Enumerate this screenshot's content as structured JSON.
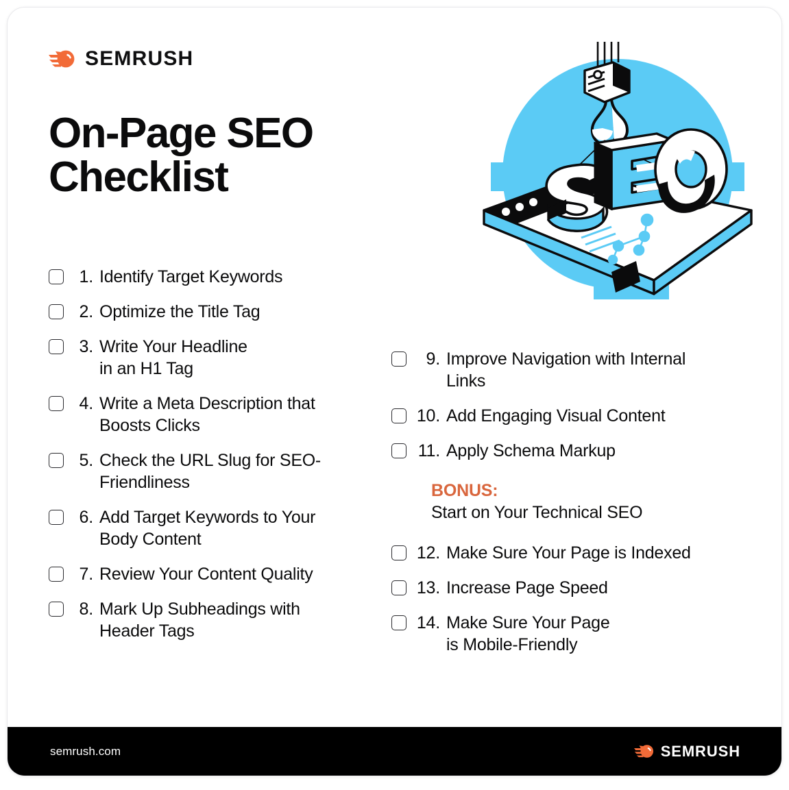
{
  "brand": {
    "name": "SEMRUSH",
    "logo_icon": "semrush-comet-icon",
    "accent_color": "#F26B38"
  },
  "title": "On-Page SEO Checklist",
  "illustration": {
    "name": "seo-crane-hook-browser-illustration",
    "word": "SEO",
    "circle_color": "#5BCBF5"
  },
  "left_column": [
    {
      "num": "1.",
      "text": "Identify Target Keywords"
    },
    {
      "num": "2.",
      "text": "Optimize the Title Tag"
    },
    {
      "num": "3.",
      "text": "Write Your Headline\nin an H1 Tag"
    },
    {
      "num": "4.",
      "text": "Write a Meta Description that\nBoosts Clicks"
    },
    {
      "num": "5.",
      "text": "Check the URL Slug for SEO-\nFriendliness"
    },
    {
      "num": "6.",
      "text": "Add Target Keywords to Your\nBody Content"
    },
    {
      "num": "7.",
      "text": "Review Your Content Quality"
    },
    {
      "num": "8.",
      "text": "Mark Up Subheadings with\nHeader Tags"
    }
  ],
  "right_column_top": [
    {
      "num": "9.",
      "text": "Improve Navigation with Internal\nLinks"
    },
    {
      "num": "10.",
      "text": "Add Engaging Visual Content"
    },
    {
      "num": "11.",
      "text": "Apply Schema Markup"
    }
  ],
  "bonus": {
    "label": "BONUS:",
    "text": "Start on Your Technical SEO",
    "color": "#D9663D"
  },
  "right_column_bottom": [
    {
      "num": "12.",
      "text": "Make Sure Your Page is Indexed"
    },
    {
      "num": "13.",
      "text": "Increase Page Speed"
    },
    {
      "num": "14.",
      "text": "Make Sure Your Page\nis Mobile-Friendly"
    }
  ],
  "footer": {
    "url": "semrush.com",
    "brand": "SEMRUSH"
  }
}
